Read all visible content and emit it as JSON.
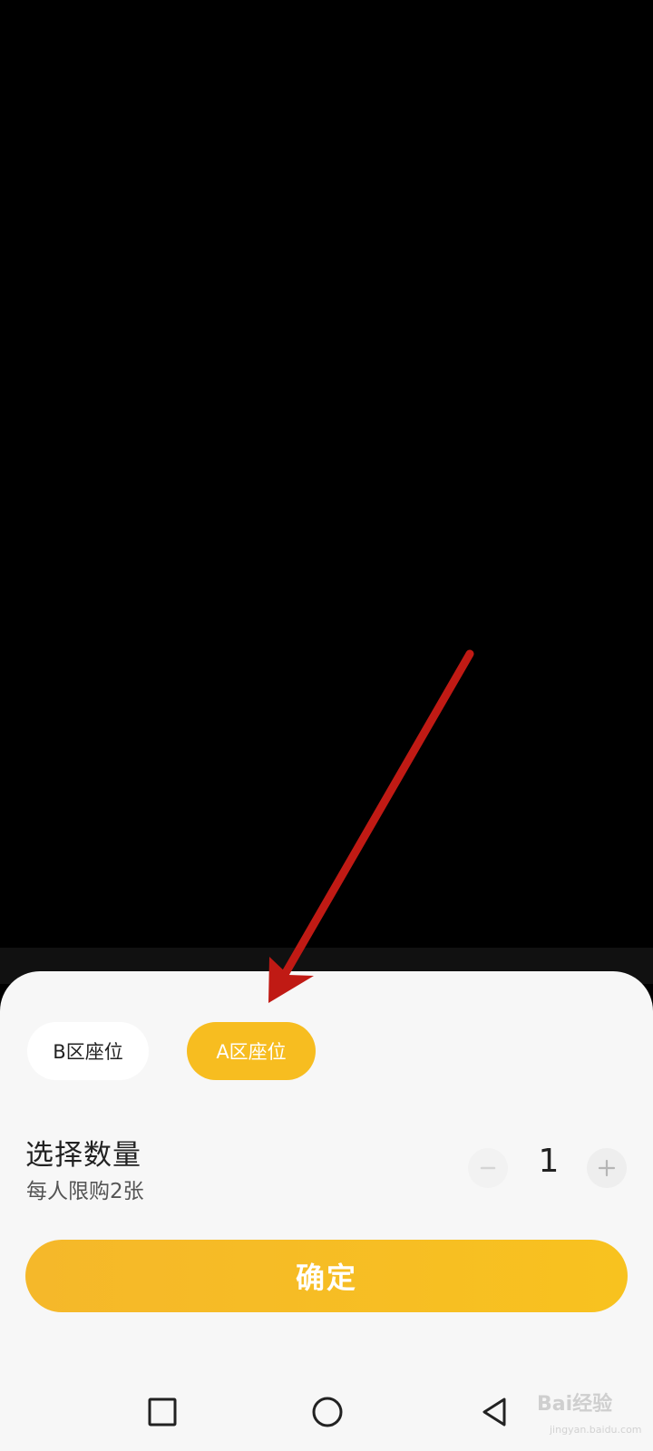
{
  "seat_tabs": [
    {
      "label": "B区座位",
      "selected": false
    },
    {
      "label": "A区座位",
      "selected": true
    }
  ],
  "quantity": {
    "title": "选择数量",
    "subtitle": "每人限购2张",
    "value": "1",
    "minus_icon": "minus-icon",
    "plus_icon": "plus-icon"
  },
  "confirm_label": "确定",
  "colors": {
    "accent": "#f7bd20",
    "sheet_bg": "#f7f7f7",
    "annotation_arrow": "#c01a14"
  },
  "nav": {
    "icons": [
      "recent-apps-icon",
      "home-icon",
      "back-icon"
    ]
  },
  "watermark": {
    "text": "Bai经验",
    "sub": "jingyan.baidu.com"
  }
}
